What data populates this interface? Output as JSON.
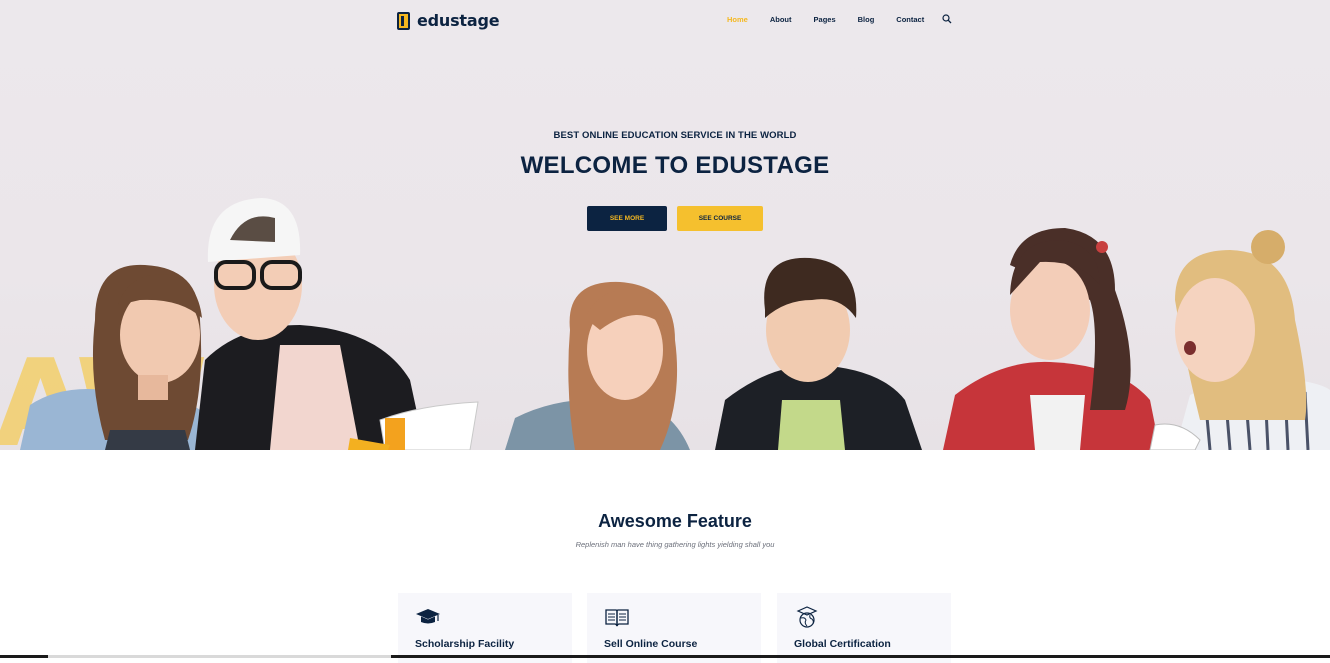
{
  "header": {
    "logo_text": "edustage",
    "nav": [
      {
        "label": "Home",
        "active": true
      },
      {
        "label": "About",
        "active": false
      },
      {
        "label": "Pages",
        "active": false
      },
      {
        "label": "Blog",
        "active": false
      },
      {
        "label": "Contact",
        "active": false
      }
    ],
    "search_icon": "search-icon"
  },
  "hero": {
    "subtitle": "BEST ONLINE EDUCATION SERVICE IN THE WORLD",
    "title": "WELCOME TO EDUSTAGE",
    "primary_button": "SEE MORE",
    "secondary_button": "SEE COURSE",
    "background_letters": "AW"
  },
  "features": {
    "title": "Awesome Feature",
    "subtitle": "Replenish man have thing gathering lights yielding shall you",
    "items": [
      {
        "icon": "graduation-cap-icon",
        "label": "Scholarship Facility"
      },
      {
        "icon": "open-book-icon",
        "label": "Sell Online Course"
      },
      {
        "icon": "certificate-globe-icon",
        "label": "Global Certification"
      }
    ]
  },
  "colors": {
    "navy": "#0c2341",
    "accent": "#f5b820",
    "hero_bg": "#ece8ec"
  }
}
